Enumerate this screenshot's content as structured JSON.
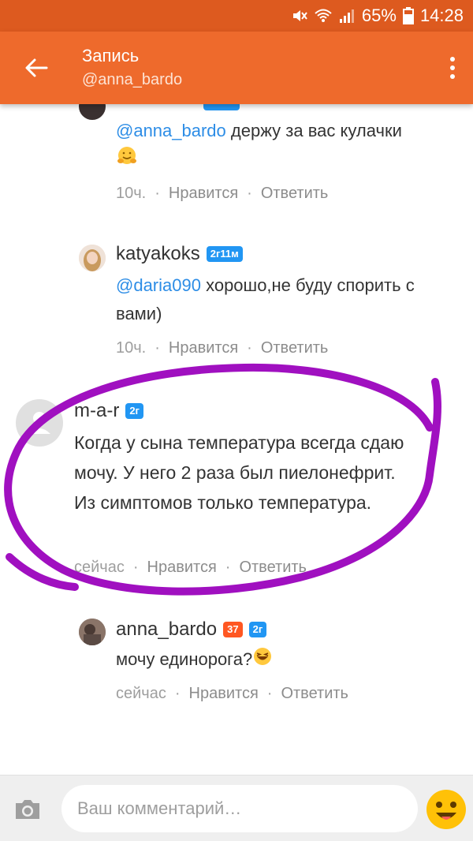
{
  "status_bar": {
    "battery": "65%",
    "time": "14:28"
  },
  "app_bar": {
    "title": "Запись",
    "subtitle": "@anna_bardo"
  },
  "comments": [
    {
      "text_mention": "@anna_bardo",
      "text": " держу за вас кулачки",
      "time": "10ч.",
      "like": "Нравится",
      "reply": "Ответить"
    },
    {
      "author": "katyakoks",
      "badge": "2г11м",
      "text_mention": "@daria090",
      "text": " хорошо,не буду спорить с вами)",
      "time": "10ч.",
      "like": "Нравится",
      "reply": "Ответить"
    },
    {
      "author": "m-a-r",
      "badge": "2г",
      "text": "Когда у сына температура всегда сдаю мочу. У него 2 раза был пиелонефрит. Из симптомов только температура.",
      "time": "сейчас",
      "like": "Нравится",
      "reply": "Ответить"
    },
    {
      "author": "anna_bardo",
      "badge_orange": "37",
      "badge": "2г",
      "text": "мочу единорога?",
      "time": "сейчас",
      "like": "Нравится",
      "reply": "Ответить"
    }
  ],
  "input": {
    "placeholder": "Ваш комментарий…"
  },
  "colors": {
    "accent": "#ee6a2c",
    "mention": "#2d8de6",
    "badge_blue": "#2196f3",
    "badge_orange": "#ff5722",
    "annotation": "#a010c0"
  },
  "icons": [
    "back-arrow-icon",
    "more-vert-icon",
    "camera-icon",
    "smiley-icon",
    "hug-emoji-icon",
    "laughing-emoji-icon"
  ]
}
